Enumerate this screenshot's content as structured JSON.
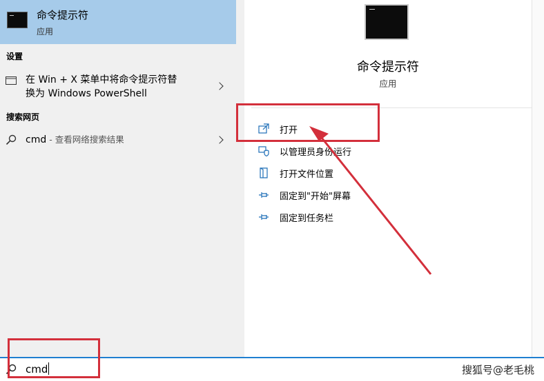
{
  "left_panel": {
    "best_match": {
      "title": "命令提示符",
      "subtitle": "应用",
      "icon": "terminal-icon"
    },
    "settings_section": {
      "header": "设置",
      "item": {
        "line1": "在 Win + X 菜单中将命令提示符替",
        "line2": "换为 Windows PowerShell",
        "icon": "window-icon"
      }
    },
    "web_section": {
      "header": "搜索网页",
      "item": {
        "query": "cmd",
        "suffix": " - 查看网络搜索结果",
        "icon": "search-icon"
      }
    }
  },
  "right_panel": {
    "app_name": "命令提示符",
    "app_type": "应用",
    "actions": [
      {
        "label": "打开",
        "icon": "open-icon"
      },
      {
        "label": "以管理员身份运行",
        "icon": "shield-icon"
      },
      {
        "label": "打开文件位置",
        "icon": "folder-icon"
      },
      {
        "label": "固定到\"开始\"屏幕",
        "icon": "pin-icon"
      },
      {
        "label": "固定到任务栏",
        "icon": "pin-icon"
      }
    ]
  },
  "search_bar": {
    "value": "cmd",
    "icon": "search-icon"
  },
  "watermark": "搜狐号@老毛桃",
  "colors": {
    "highlight": "#a6cbea",
    "accent": "#1f7fd0",
    "annotation": "#d32f3b"
  }
}
